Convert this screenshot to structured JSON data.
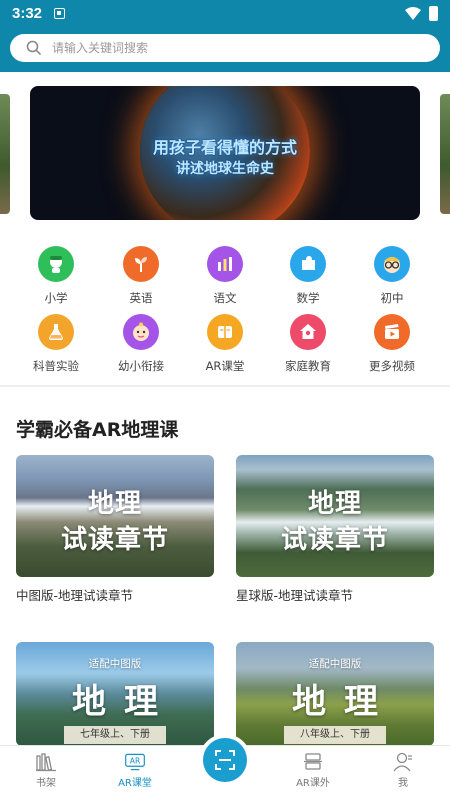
{
  "status_bar": {
    "time": "3:32",
    "notification_icon": "notification-square-icon",
    "wifi_icon": "wifi-icon",
    "battery_icon": "battery-icon"
  },
  "search": {
    "placeholder": "请输入关键词搜索",
    "icon": "search-icon"
  },
  "banner": {
    "line1": "用孩子看得懂的方式",
    "line2": "讲述地球生命史"
  },
  "categories": [
    {
      "label": "小学",
      "icon": "child-avatar-icon",
      "color": "#2fbf5a"
    },
    {
      "label": "英语",
      "icon": "sprout-icon",
      "color": "#f06a2a"
    },
    {
      "label": "语文",
      "icon": "chart-bars-icon",
      "color": "#a454e6"
    },
    {
      "label": "数学",
      "icon": "puzzle-icon",
      "color": "#2aa6ea"
    },
    {
      "label": "初中",
      "icon": "glasses-face-icon",
      "color": "#2aa6ea"
    },
    {
      "label": "科普实验",
      "icon": "flask-icon",
      "color": "#f3a42a"
    },
    {
      "label": "幼小衔接",
      "icon": "baby-face-icon",
      "color": "#a454e6"
    },
    {
      "label": "AR课堂",
      "icon": "book-icon",
      "color": "#f5a623"
    },
    {
      "label": "家庭教育",
      "icon": "house-icon",
      "color": "#ee4a6a"
    },
    {
      "label": "更多视频",
      "icon": "clapperboard-icon",
      "color": "#f06a2a"
    }
  ],
  "section": {
    "title": "学霸必备AR地理课"
  },
  "courses": [
    {
      "img_line1": "地理",
      "img_line2": "试读章节",
      "caption": "中图版-地理试读章节"
    },
    {
      "img_line1": "地理",
      "img_line2": "试读章节",
      "caption": "星球版-地理试读章节"
    }
  ],
  "books": [
    {
      "adapt": "适配中图版",
      "title": "地理",
      "grade": "七年级上、下册"
    },
    {
      "adapt": "适配中图版",
      "title": "地理",
      "grade": "八年级上、下册"
    }
  ],
  "tabbar": {
    "tabs": [
      {
        "label": "书架",
        "icon": "bookshelf-icon"
      },
      {
        "label": "AR课堂",
        "icon": "ar-classroom-icon"
      },
      {
        "label": "AR课外",
        "icon": "ar-extracurricular-icon"
      },
      {
        "label": "我",
        "icon": "profile-icon"
      }
    ],
    "scan_icon": "scan-icon",
    "active_color": "#1a8fc2"
  },
  "colors": {
    "header": "#0f87aa",
    "accent": "#1a9ed0"
  }
}
